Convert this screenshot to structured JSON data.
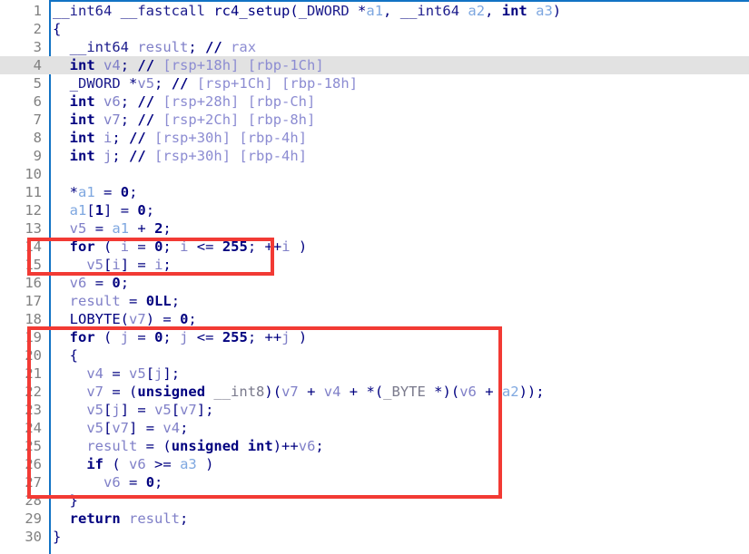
{
  "view": {
    "app": "IDA Pro Hex-Rays Decompiler",
    "pane": "Pseudocode",
    "function_name": "rc4_setup",
    "total_lines": 30,
    "highlighted_line": 4,
    "colors": {
      "background": "#ffffff",
      "gutter_rule": "#1273c4",
      "line_highlight": "#e2e2e2",
      "annotation_red": "#f23a34",
      "keyword": "#00007f",
      "local_var": "#8080c8",
      "argument": "#7ea7e0",
      "comment": "#8c8cd2",
      "type_gray": "#7a7a8c",
      "line_number": "#808080"
    }
  },
  "line_numbers": [
    "1",
    "2",
    "3",
    "4",
    "5",
    "6",
    "7",
    "8",
    "9",
    "10",
    "11",
    "12",
    "13",
    "14",
    "15",
    "16",
    "17",
    "18",
    "19",
    "20",
    "21",
    "22",
    "23",
    "24",
    "25",
    "26",
    "27",
    "28",
    "29",
    "30"
  ],
  "code_lines": [
    "__int64 __fastcall rc4_setup(_DWORD *a1, __int64 a2, int a3)",
    "{",
    "  __int64 result; // rax",
    "  int v4; // [rsp+18h] [rbp-1Ch]",
    "  _DWORD *v5; // [rsp+1Ch] [rbp-18h]",
    "  int v6; // [rsp+28h] [rbp-Ch]",
    "  int v7; // [rsp+2Ch] [rbp-8h]",
    "  int i; // [rsp+30h] [rbp-4h]",
    "  int j; // [rsp+30h] [rbp-4h]",
    "",
    "  *a1 = 0;",
    "  a1[1] = 0;",
    "  v5 = a1 + 2;",
    "  for ( i = 0; i <= 255; ++i )",
    "    v5[i] = i;",
    "  v6 = 0;",
    "  result = 0LL;",
    "  LOBYTE(v7) = 0;",
    "  for ( j = 0; j <= 255; ++j )",
    "  {",
    "    v4 = v5[j];",
    "    v7 = (unsigned __int8)(v7 + v4 + *(_BYTE *)(v6 + a2));",
    "    v5[j] = v5[v7];",
    "    v5[v7] = v4;",
    "    result = (unsigned int)++v6;",
    "    if ( v6 >= a3 )",
    "      v6 = 0;",
    "  }",
    "  return result;",
    "}"
  ],
  "annotations": [
    {
      "label": "ksa-identity-init-loop",
      "lines": "14-15"
    },
    {
      "label": "ksa-key-scheduling-loop",
      "lines": "19-28"
    }
  ]
}
